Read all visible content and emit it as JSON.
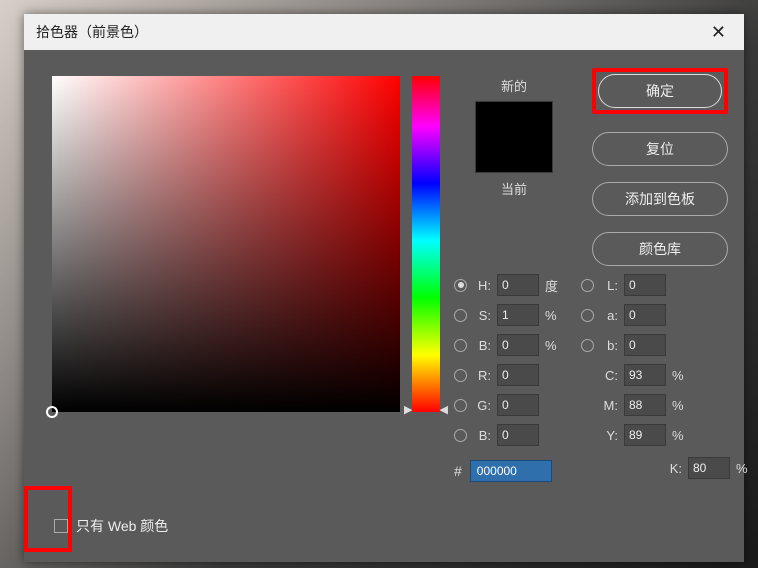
{
  "title": "拾色器（前景色）",
  "buttons": {
    "ok": "确定",
    "reset": "复位",
    "add_to_swatch": "添加到色板",
    "color_lib": "颜色库"
  },
  "preview": {
    "new_label": "新的",
    "current_label": "当前"
  },
  "hsb": {
    "h_label": "H:",
    "h_val": "0",
    "h_unit": "度",
    "s_label": "S:",
    "s_val": "1",
    "s_unit": "%",
    "b_label": "B:",
    "b_val": "0",
    "b_unit": "%"
  },
  "rgb": {
    "r_label": "R:",
    "r_val": "0",
    "g_label": "G:",
    "g_val": "0",
    "b_label": "B:",
    "b_val": "0"
  },
  "lab": {
    "l_label": "L:",
    "l_val": "0",
    "a_label": "a:",
    "a_val": "0",
    "b_label": "b:",
    "b_val": "0"
  },
  "cmyk": {
    "c_label": "C:",
    "c_val": "93",
    "unit": "%",
    "m_label": "M:",
    "m_val": "88",
    "y_label": "Y:",
    "y_val": "89",
    "k_label": "K:",
    "k_val": "80"
  },
  "hex": "000000",
  "web_only_label": "只有 Web 颜色"
}
